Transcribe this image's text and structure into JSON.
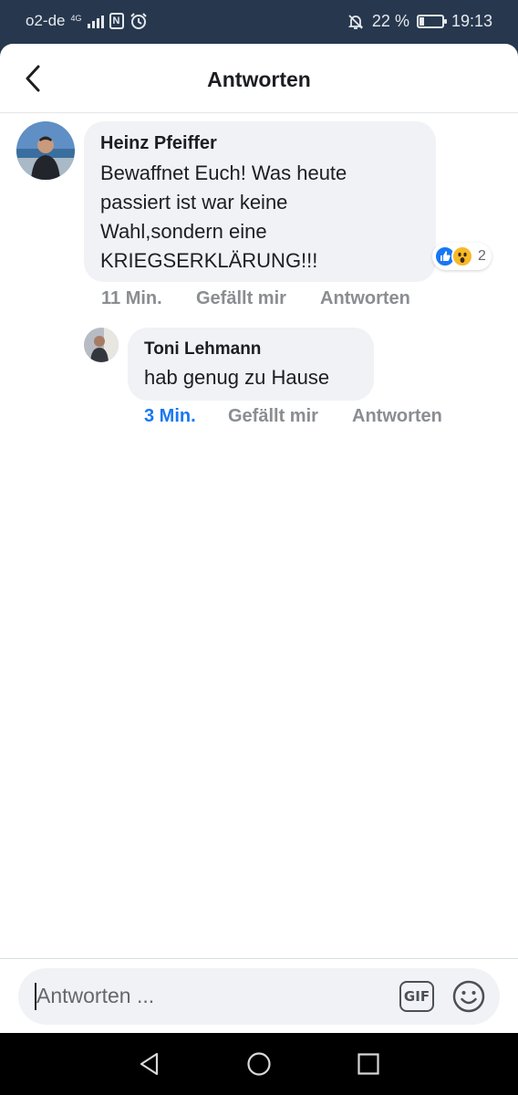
{
  "status_bar": {
    "carrier": "o2-de",
    "network": "4G",
    "battery_percent": "22 %",
    "battery_level": 0.22,
    "time": "19:13"
  },
  "header": {
    "title": "Antworten"
  },
  "comments": [
    {
      "author": "Heinz Pfeiffer",
      "text_lines": [
        "Bewaffnet Euch! Was heute",
        "passiert ist war keine",
        "Wahl,sondern eine",
        "KRIEGSERKLÄRUNG!!!"
      ],
      "time": "11 Min.",
      "like_label": "Gefällt mir",
      "reply_label": "Antworten",
      "reactions": {
        "types": [
          "like-icon",
          "wow-icon"
        ],
        "count": "2"
      }
    },
    {
      "author": "Toni Lehmann",
      "text": "hab genug zu Hause",
      "time": "3 Min.",
      "like_label": "Gefällt mir",
      "reply_label": "Antworten"
    }
  ],
  "composer": {
    "placeholder": "Antworten ...",
    "gif_label": "GIF"
  },
  "colors": {
    "status_bar_bg": "#27384e",
    "bubble_bg": "#f0f2f5",
    "accent": "#1877f2",
    "meta_gray": "#8a8d91"
  }
}
